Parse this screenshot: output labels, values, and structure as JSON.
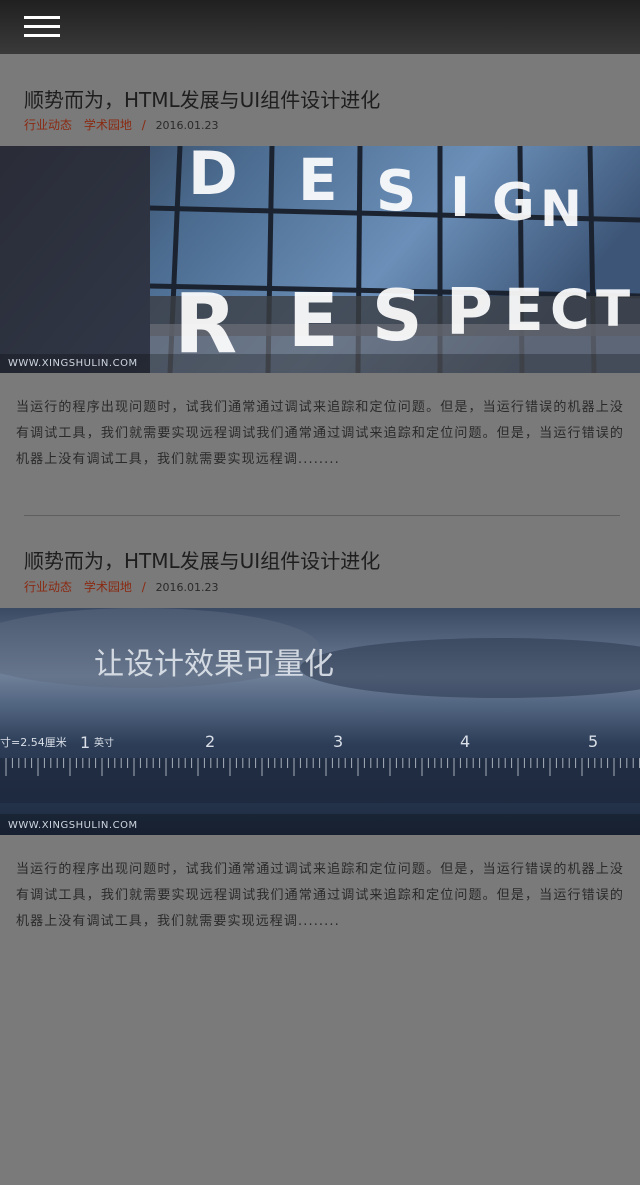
{
  "articles": [
    {
      "title": "顺势而为，HTML发展与UI组件设计进化",
      "tags": [
        "行业动态",
        "学术园地"
      ],
      "separator": "/",
      "date": "2016.01.23",
      "image_watermark": "WWW.XINGSHULIN.COM",
      "image_text": [
        "D",
        "E",
        "S",
        "I",
        "G",
        "N",
        "R",
        "E",
        "S",
        "P",
        "E",
        "C",
        "T"
      ],
      "excerpt": "当运行的程序出现问题时，试我们通常通过调试来追踪和定位问题。但是，当运行错误的机器上没有调试工具，我们就需要实现远程调试我们通常通过调试来追踪和定位问题。但是，当运行错误的机器上没有调试工具，我们就需要实现远程调........"
    },
    {
      "title": "顺势而为，HTML发展与UI组件设计进化",
      "tags": [
        "行业动态",
        "学术园地"
      ],
      "separator": "/",
      "date": "2016.01.23",
      "image_watermark": "WWW.XINGSHULIN.COM",
      "image_headline": "让设计效果可量化",
      "image_ruler": {
        "unit_label": "寸=2.54厘米",
        "first_label": "1",
        "first_unit": "英寸",
        "marks": [
          "2",
          "3",
          "4",
          "5"
        ]
      },
      "excerpt": "当运行的程序出现问题时，试我们通常通过调试来追踪和定位问题。但是，当运行错误的机器上没有调试工具，我们就需要实现远程调试我们通常通过调试来追踪和定位问题。但是，当运行错误的机器上没有调试工具，我们就需要实现远程调........"
    }
  ]
}
